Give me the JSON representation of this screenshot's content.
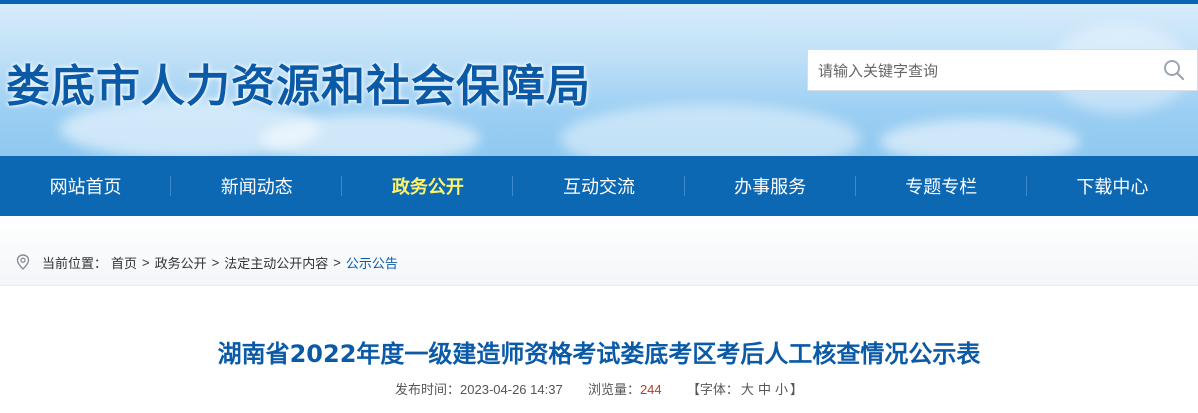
{
  "header": {
    "site_title": "娄底市人力资源和社会保障局",
    "search_placeholder": "请输入关键字查询"
  },
  "nav": {
    "items": [
      {
        "label": "网站首页"
      },
      {
        "label": "新闻动态"
      },
      {
        "label": "政务公开",
        "active": true
      },
      {
        "label": "互动交流"
      },
      {
        "label": "办事服务"
      },
      {
        "label": "专题专栏"
      },
      {
        "label": "下载中心"
      }
    ]
  },
  "breadcrumb": {
    "prefix": "当前位置：",
    "items": [
      "首页",
      "政务公开",
      "法定主动公开内容",
      "公示公告"
    ],
    "separator": ">"
  },
  "article": {
    "title": "湖南省2022年度一级建造师资格考试娄底考区考后人工核查情况公示表",
    "published_label": "发布时间：",
    "published": "2023-04-26 14:37",
    "views_label": "浏览量：",
    "views": "244",
    "font_label_open": "【字体：",
    "font_large": "大",
    "font_medium": "中",
    "font_small": "小",
    "font_label_close": "】"
  },
  "colors": {
    "brand": "#0b5aa8",
    "nav_bg": "#0d68b4",
    "nav_active": "#fff36a",
    "views": "#c0392b"
  },
  "icons": {
    "search": "search-icon",
    "location": "location-pin-icon"
  }
}
